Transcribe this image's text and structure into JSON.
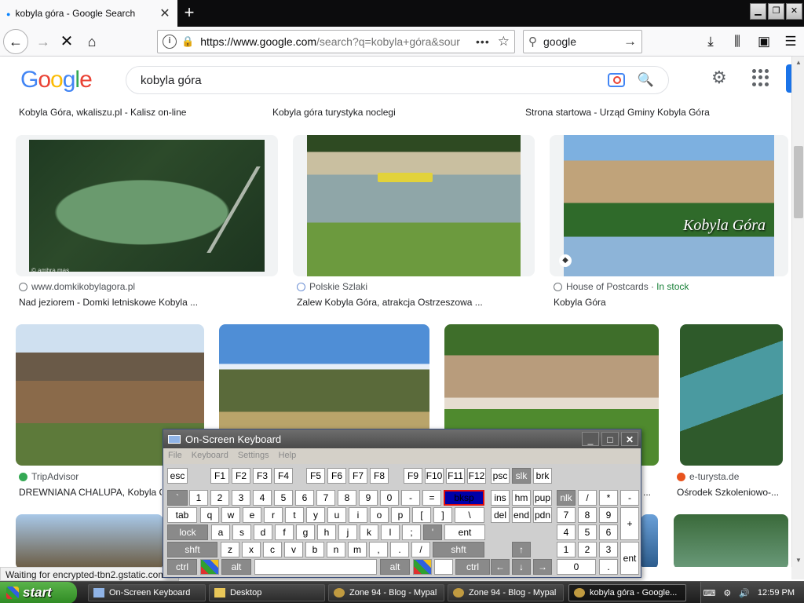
{
  "browser": {
    "tab_title": "kobyla góra - Google Search",
    "url_host": "https://www.google.com",
    "url_path": "/search?q=kobyla+góra&sour",
    "search_engine_query": "google"
  },
  "google": {
    "logo": [
      "G",
      "o",
      "o",
      "g",
      "l",
      "e"
    ],
    "query": "kobyla góra"
  },
  "results": {
    "row0": [
      {
        "caption": "Kobyla Góra, wkaliszu.pl - Kalisz on-line"
      },
      {
        "caption": "Kobyla góra turystyka noclegi"
      },
      {
        "caption": "Strona startowa - Urząd Gminy Kobyla Góra"
      }
    ],
    "row1": [
      {
        "source": "www.domkikobylagora.pl",
        "caption": "Nad jeziorem - Domki letniskowe Kobyla ...",
        "watermark": "© ambra.mas"
      },
      {
        "source": "Polskie Szlaki",
        "caption": "Zalew Kobyla Góra, atrakcja Ostrzeszowa ..."
      },
      {
        "source": "House of Postcards ·",
        "in_stock": "In stock",
        "caption": "Kobyla Góra",
        "postcard_text": "Kobyla Góra"
      }
    ],
    "row2": [
      {
        "source": "TripAdvisor",
        "caption": "DREWNIANA CHALUPA, Kobyla G"
      },
      {
        "source": "",
        "caption": ""
      },
      {
        "source": "",
        "caption": "..."
      },
      {
        "source": "e-turysta.de",
        "caption": "Ośrodek Szkoleniowo-..."
      }
    ]
  },
  "status_text": "Waiting for encrypted-tbn2.gstatic.com...",
  "osk": {
    "title": "On-Screen Keyboard",
    "menu": [
      "File",
      "Keyboard",
      "Settings",
      "Help"
    ],
    "rows": [
      [
        "esc",
        "F1",
        "F2",
        "F3",
        "F4",
        "F5",
        "F6",
        "F7",
        "F8",
        "F9",
        "F10",
        "F11",
        "F12",
        "psc",
        "slk",
        "brk"
      ],
      [
        "`",
        "1",
        "2",
        "3",
        "4",
        "5",
        "6",
        "7",
        "8",
        "9",
        "0",
        "-",
        "=",
        "bksp",
        "ins",
        "hm",
        "pup",
        "nlk",
        "/",
        "*",
        "-"
      ],
      [
        "tab",
        "q",
        "w",
        "e",
        "r",
        "t",
        "y",
        "u",
        "i",
        "o",
        "p",
        "[",
        "]",
        "\\",
        "del",
        "end",
        "pdn",
        "7",
        "8",
        "9",
        "+"
      ],
      [
        "lock",
        "a",
        "s",
        "d",
        "f",
        "g",
        "h",
        "j",
        "k",
        "l",
        ";",
        "'",
        "ent",
        "4",
        "5",
        "6"
      ],
      [
        "shft",
        "z",
        "x",
        "c",
        "v",
        "b",
        "n",
        "m",
        ",",
        ".",
        "/",
        "shft",
        "↑",
        "1",
        "2",
        "3",
        "ent"
      ],
      [
        "ctrl",
        "",
        "alt",
        "",
        "alt",
        "",
        "",
        "ctrl",
        "←",
        "↓",
        "→",
        "0",
        "."
      ]
    ]
  },
  "taskbar": {
    "start": "start",
    "tasks": [
      "On-Screen Keyboard",
      "Desktop",
      "Zone 94 - Blog - Mypal",
      "Zone 94 - Blog - Mypal",
      "kobyla góra - Google..."
    ],
    "clock": "12:59 PM"
  }
}
